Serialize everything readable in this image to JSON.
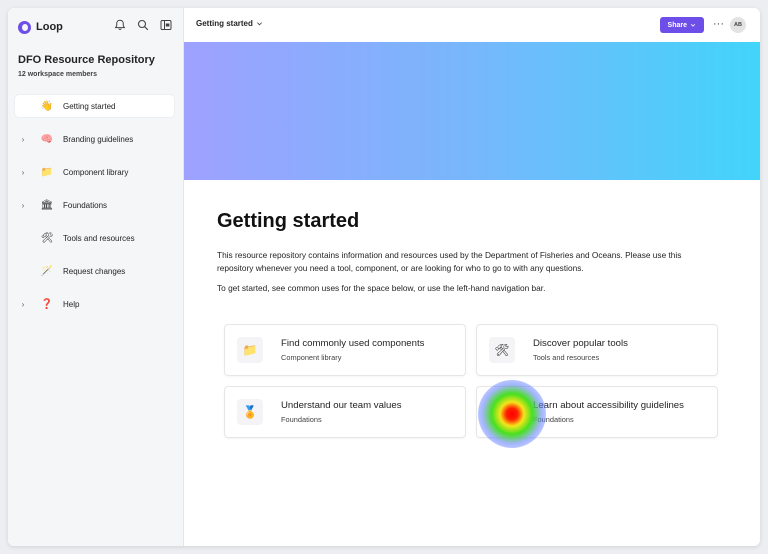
{
  "app": {
    "name": "Loop",
    "accent": "#6d4ee8"
  },
  "sidebar": {
    "workspace_title": "DFO Resource Repository",
    "workspace_members": "12 workspace members",
    "icons": [
      "bell-icon",
      "search-icon",
      "panel-toggle-icon"
    ],
    "items": [
      {
        "label": "Getting started",
        "emoji": "👋",
        "has_chevron": false,
        "active": true
      },
      {
        "label": "Branding guidelines",
        "emoji": "🧠",
        "has_chevron": true,
        "active": false
      },
      {
        "label": "Component library",
        "emoji": "📁",
        "has_chevron": true,
        "active": false
      },
      {
        "label": "Foundations",
        "emoji": "🏛",
        "has_chevron": true,
        "active": false
      },
      {
        "label": "Tools and resources",
        "emoji": "🛠",
        "has_chevron": false,
        "active": false
      },
      {
        "label": "Request changes",
        "emoji": "🪄",
        "has_chevron": false,
        "active": false
      },
      {
        "label": "Help",
        "emoji": "❓",
        "has_chevron": true,
        "active": false
      }
    ]
  },
  "header": {
    "page_name": "Getting started",
    "share_label": "Share",
    "more_label": "···",
    "avatar_initials": "AB"
  },
  "banner": {
    "gradient": [
      "#9ea1ff",
      "#77b7fb",
      "#42d4fa"
    ]
  },
  "main": {
    "title": "Getting started",
    "description": "This resource repository contains information and resources used by the Department of Fisheries and Oceans. Please use this repository whenever you need a tool, component, or are looking for who to go to with any questions.",
    "instruction": "To get started, see common uses for the space below, or use the left-hand navigation bar.",
    "cards": [
      {
        "title": "Find commonly used components",
        "subtitle": "Component library",
        "emoji": "📁"
      },
      {
        "title": "Discover popular tools",
        "subtitle": "Tools and resources",
        "emoji": "🛠"
      },
      {
        "title": "Understand our team values",
        "subtitle": "Foundations",
        "emoji": "🏅"
      },
      {
        "title": "Learn about accessibility guidelines",
        "subtitle": "Foundations",
        "emoji": "🏛"
      }
    ]
  }
}
